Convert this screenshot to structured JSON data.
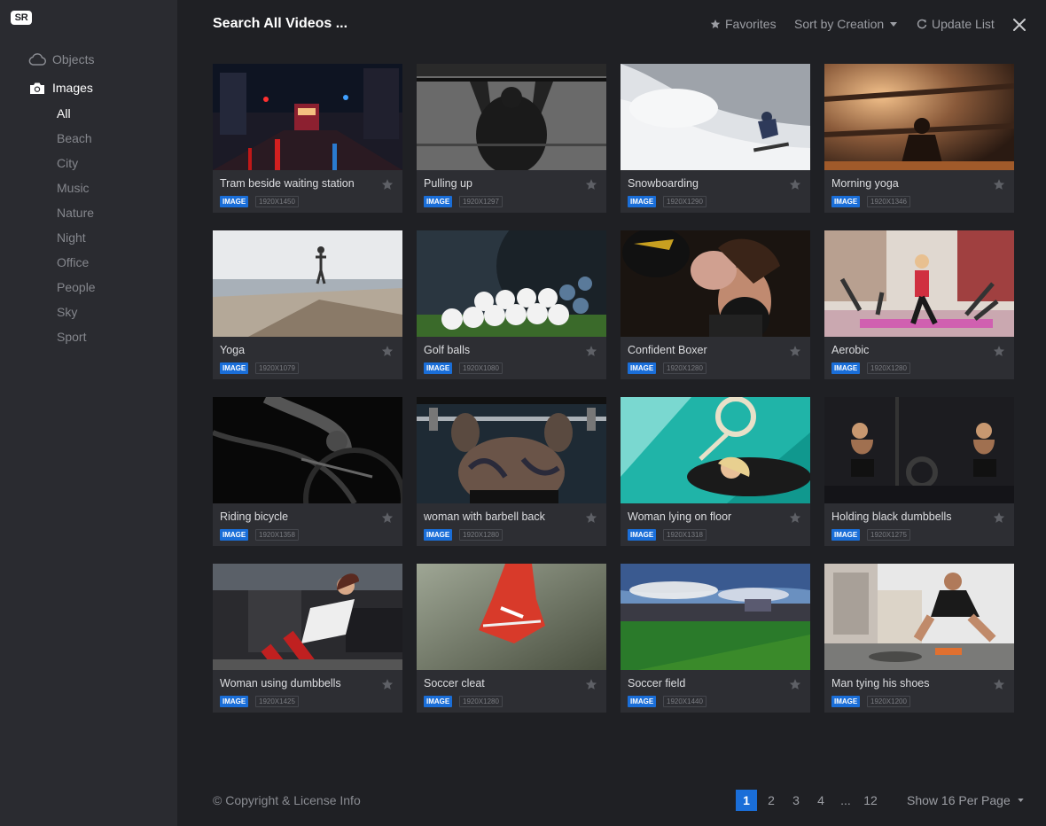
{
  "app": {
    "logo_text": "SR"
  },
  "sidebar": {
    "objects_label": "Objects",
    "images_label": "Images",
    "categories": [
      "All",
      "Beach",
      "City",
      "Music",
      "Nature",
      "Night",
      "Office",
      "People",
      "Sky",
      "Sport"
    ],
    "active_category": "All"
  },
  "header": {
    "title": "Search All Videos ...",
    "favorites_label": "Favorites",
    "sort_label": "Sort by Creation",
    "update_label": "Update List"
  },
  "cards": [
    {
      "title": "Tram beside waiting station",
      "type": "IMAGE",
      "dims": "1920X1450"
    },
    {
      "title": "Pulling up",
      "type": "IMAGE",
      "dims": "1920X1297"
    },
    {
      "title": "Snowboarding",
      "type": "IMAGE",
      "dims": "1920X1290"
    },
    {
      "title": "Morning yoga",
      "type": "IMAGE",
      "dims": "1920X1346"
    },
    {
      "title": "Yoga",
      "type": "IMAGE",
      "dims": "1920X1079"
    },
    {
      "title": "Golf balls",
      "type": "IMAGE",
      "dims": "1920X1080"
    },
    {
      "title": "Confident Boxer",
      "type": "IMAGE",
      "dims": "1920X1280"
    },
    {
      "title": "Aerobic",
      "type": "IMAGE",
      "dims": "1920X1280"
    },
    {
      "title": "Riding bicycle",
      "type": "IMAGE",
      "dims": "1920X1358"
    },
    {
      "title": "woman with barbell back",
      "type": "IMAGE",
      "dims": "1920X1280"
    },
    {
      "title": "Woman lying on floor",
      "type": "IMAGE",
      "dims": "1920X1318"
    },
    {
      "title": "Holding black dumbbells",
      "type": "IMAGE",
      "dims": "1920X1275"
    },
    {
      "title": "Woman using dumbbells",
      "type": "IMAGE",
      "dims": "1920X1425"
    },
    {
      "title": "Soccer cleat",
      "type": "IMAGE",
      "dims": "1920X1280"
    },
    {
      "title": "Soccer field",
      "type": "IMAGE",
      "dims": "1920X1440"
    },
    {
      "title": "Man tying his shoes",
      "type": "IMAGE",
      "dims": "1920X1200"
    }
  ],
  "footer": {
    "copyright": "© Copyright & License Info",
    "pages": [
      "1",
      "2",
      "3",
      "4",
      "...",
      "12"
    ],
    "current_page": "1",
    "per_page_label": "Show 16 Per Page"
  },
  "colors": {
    "accent": "#1a6ed8",
    "background": "#1f2024",
    "sidebar": "#2a2b30",
    "card": "#2d2e33"
  }
}
